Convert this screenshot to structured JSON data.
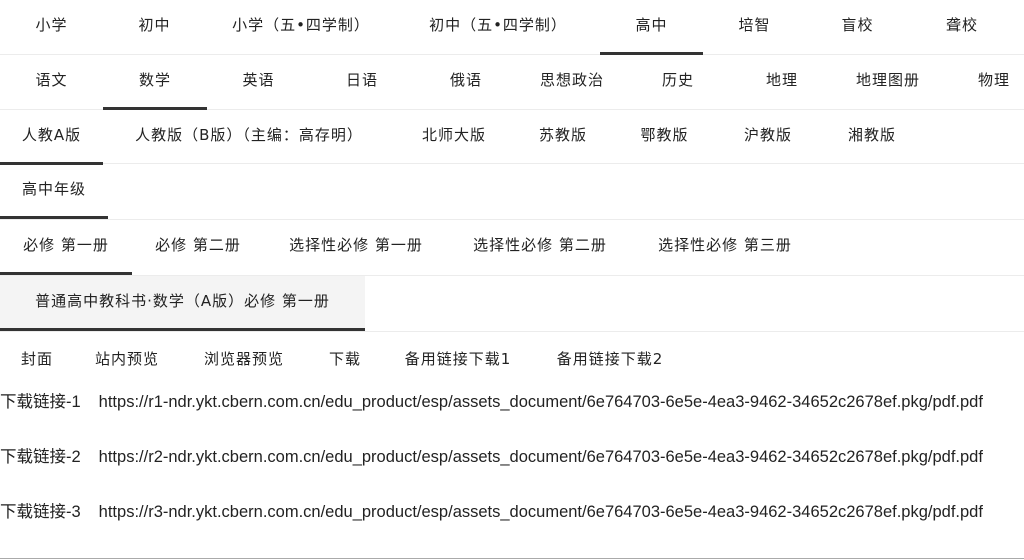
{
  "levels": [
    "小学",
    "初中",
    "小学（五•四学制）",
    "初中（五•四学制）",
    "高中",
    "培智",
    "盲校",
    "聋校"
  ],
  "subjects": [
    "语文",
    "数学",
    "英语",
    "日语",
    "俄语",
    "思想政治",
    "历史",
    "地理",
    "地理图册",
    "物理"
  ],
  "editions": [
    "人教A版",
    "人教版（B版）（主编：高存明）",
    "北师大版",
    "苏教版",
    "鄂教版",
    "沪教版",
    "湘教版"
  ],
  "grades": [
    "高中年级"
  ],
  "volumes": [
    "必修 第一册",
    "必修 第二册",
    "选择性必修 第一册",
    "选择性必修 第二册",
    "选择性必修 第三册"
  ],
  "books": [
    "普通高中教科书·数学（A版）必修 第一册"
  ],
  "actions": [
    "封面",
    "站内预览",
    "浏览器预览",
    "下载",
    "备用链接下载1",
    "备用链接下载2"
  ],
  "downloads": [
    {
      "label": "下载链接-1",
      "url": "https://r1-ndr.ykt.cbern.com.cn/edu_product/esp/assets_document/6e764703-6e5e-4ea3-9462-34652c2678ef.pkg/pdf.pdf"
    },
    {
      "label": "下载链接-2",
      "url": "https://r2-ndr.ykt.cbern.com.cn/edu_product/esp/assets_document/6e764703-6e5e-4ea3-9462-34652c2678ef.pkg/pdf.pdf"
    },
    {
      "label": "下载链接-3",
      "url": "https://r3-ndr.ykt.cbern.com.cn/edu_product/esp/assets_document/6e764703-6e5e-4ea3-9462-34652c2678ef.pkg/pdf.pdf"
    }
  ],
  "selected": {
    "level": "高中",
    "subject": "数学",
    "edition": "人教A版",
    "grade": "高中年级",
    "volume": "必修 第一册",
    "book": "普通高中教科书·数学（A版）必修 第一册"
  },
  "colors": {
    "active_underline": "#333333",
    "divider": "#ececec",
    "selected_bg": "#f4f4f4",
    "text": "#222222"
  }
}
